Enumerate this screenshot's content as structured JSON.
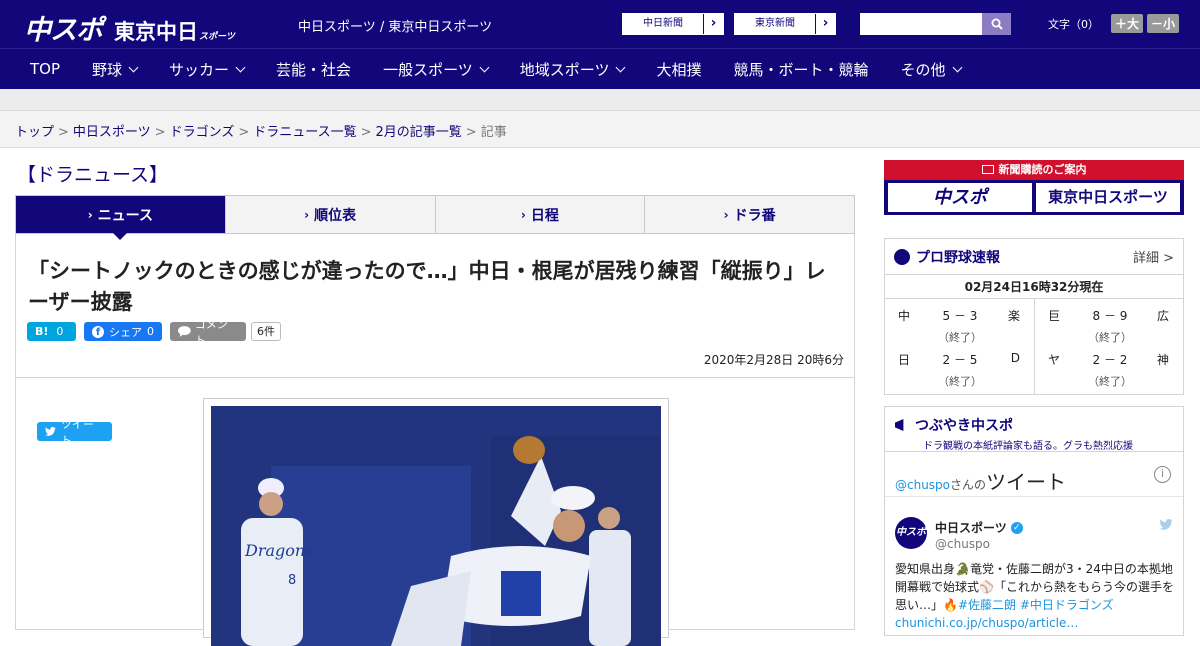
{
  "header": {
    "logo_main": "中スポ",
    "logo_sub": "東京中日",
    "logo_sub_small": "スポーツ",
    "site_links": "中日スポーツ / 東京中日スポーツ",
    "paper_links": [
      "中日新聞",
      "東京新聞"
    ],
    "font_label": "文字（0）",
    "font_plus": "＋大",
    "font_minus": "－小",
    "search_placeholder": ""
  },
  "nav": {
    "items": [
      {
        "label": "TOP",
        "dropdown": false
      },
      {
        "label": "野球",
        "dropdown": true
      },
      {
        "label": "サッカー",
        "dropdown": true
      },
      {
        "label": "芸能・社会",
        "dropdown": false
      },
      {
        "label": "一般スポーツ",
        "dropdown": true
      },
      {
        "label": "地域スポーツ",
        "dropdown": true
      },
      {
        "label": "大相撲",
        "dropdown": false
      },
      {
        "label": "競馬・ボート・競輪",
        "dropdown": false
      },
      {
        "label": "その他",
        "dropdown": true
      }
    ]
  },
  "breadcrumb": {
    "items": [
      "トップ",
      "中日スポーツ",
      "ドラゴンズ",
      "ドラニュース一覧",
      "2月の記事一覧"
    ],
    "current": "記事"
  },
  "section": {
    "title": "【ドラニュース】",
    "tabs": [
      "ニュース",
      "順位表",
      "日程",
      "ドラ番"
    ]
  },
  "article": {
    "headline": "「シートノックのときの感じが違ったので…」中日・根尾が居残り練習「縦振り」レーザー披露",
    "share": {
      "tweet": "ツイート",
      "hatena_label": "B!",
      "hatena_count": "0",
      "facebook": "シェア",
      "facebook_count": "0",
      "comment": "コメント",
      "comment_count": "6件"
    },
    "date": "2020年2月28日 20時6分"
  },
  "sidebar": {
    "promo_title": "新聞購読のご案内",
    "promo_buttons": [
      "中スポ",
      "東京中日スポーツ"
    ],
    "score": {
      "title": "プロ野球速報",
      "more": "詳細 >",
      "time": "02月24日16時32分現在",
      "games": [
        {
          "home": "中",
          "score": "5 － 3",
          "away": "楽",
          "status": "（終了）"
        },
        {
          "home": "日",
          "score": "2 － 5",
          "away": "D",
          "status": "（終了）"
        },
        {
          "home": "巨",
          "score": "8 － 9",
          "away": "広",
          "status": "（終了）"
        },
        {
          "home": "ヤ",
          "score": "2 － 2",
          "away": "神",
          "status": "（終了）"
        }
      ]
    },
    "tsubuyaki": {
      "title": "つぶやき中スポ",
      "subtitle": "ドラ観戦の本紙評論家も語る。グラも熱烈応援",
      "user_handle_link": "@chuspo",
      "user_suffix": "さんの",
      "tweets_word": "ツイート",
      "tweet_name": "中日スポーツ",
      "tweet_handle": "@chuspo",
      "tweet_text": "愛知県出身🐊竜党・佐藤二朗が3・24中日の本拠地開幕戦で始球式⚾「これから熱をもらう今の選手を思い…」🔥",
      "tweet_tags": "#佐藤二朗 #中日ドラゴンズ",
      "tweet_link": "chunichi.co.jp/chuspo/article…"
    }
  }
}
